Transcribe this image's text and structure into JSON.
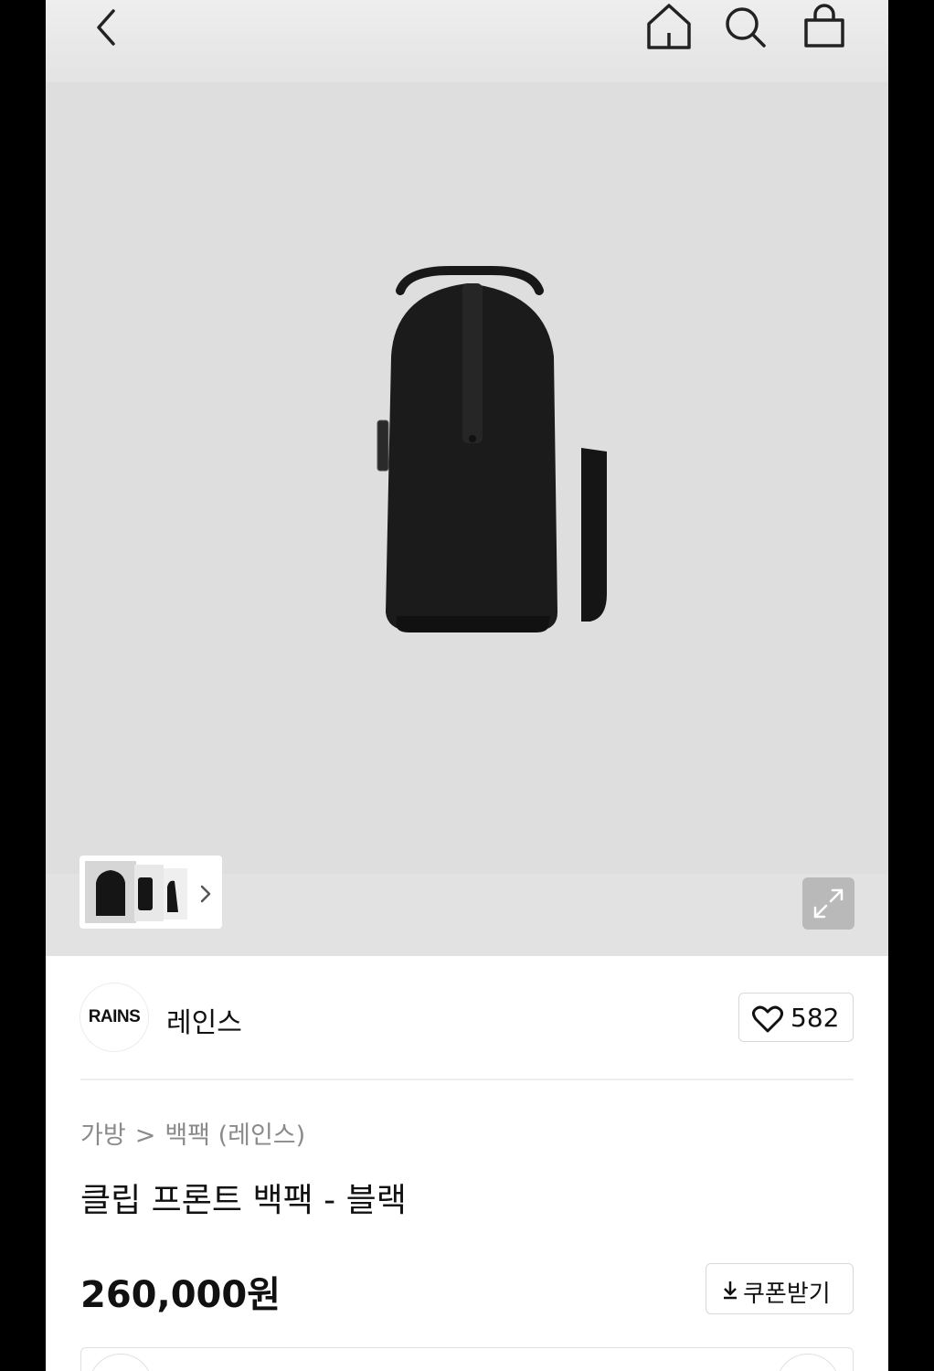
{
  "header": {
    "back_icon": "chevron-left-icon",
    "home_icon": "home-icon",
    "search_icon": "search-icon",
    "bag_icon": "shopping-bag-icon"
  },
  "gallery": {
    "thumb_next_icon": "chevron-right-icon",
    "expand_icon": "expand-icon"
  },
  "brand": {
    "logo_text": "RAINS",
    "name": "레인스"
  },
  "likes": {
    "icon": "heart-icon",
    "count": "582"
  },
  "breadcrumb": {
    "category": "가방",
    "separator": ">",
    "subcategory": "백팩 (레인스)"
  },
  "product": {
    "title": "클립 프론트 백팩 - 블랙",
    "price": "260,000원"
  },
  "coupon": {
    "icon": "download-icon",
    "label": "쿠폰받기"
  },
  "colors": {
    "hero_bg": "#dedede",
    "text": "#111111",
    "muted": "#8b8b8b"
  }
}
